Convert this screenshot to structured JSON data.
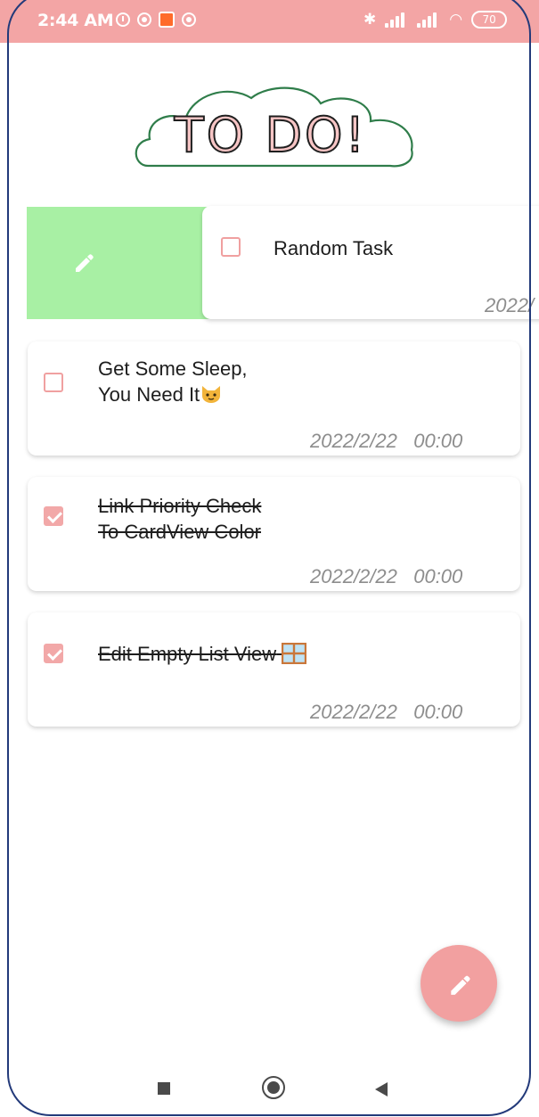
{
  "status_bar": {
    "time": "2:44 AM",
    "battery": "70",
    "background_color": "#f3a5a5"
  },
  "logo": {
    "text": "TO DO!"
  },
  "swipe_action": {
    "icon": "edit-icon",
    "color": "#a8f0a4"
  },
  "tasks": [
    {
      "title": "Random Task",
      "date": "2022/",
      "checked": false
    },
    {
      "title": "Get Some Sleep,\nYou Need It",
      "emoji": "cat-face",
      "date": "2022/2/22",
      "time": "00:00",
      "checked": false
    },
    {
      "title": "Link Priority Check\nTo CardView Color",
      "date": "2022/2/22",
      "time": "00:00",
      "checked": true
    },
    {
      "title": "Edit Empty List View",
      "emoji": "window",
      "date": "2022/2/22",
      "time": "00:00",
      "checked": true
    }
  ],
  "fab": {
    "icon": "edit-icon",
    "color": "#f2a0a0"
  },
  "nav": {
    "icons": [
      "recents-icon",
      "home-icon",
      "back-icon"
    ]
  }
}
